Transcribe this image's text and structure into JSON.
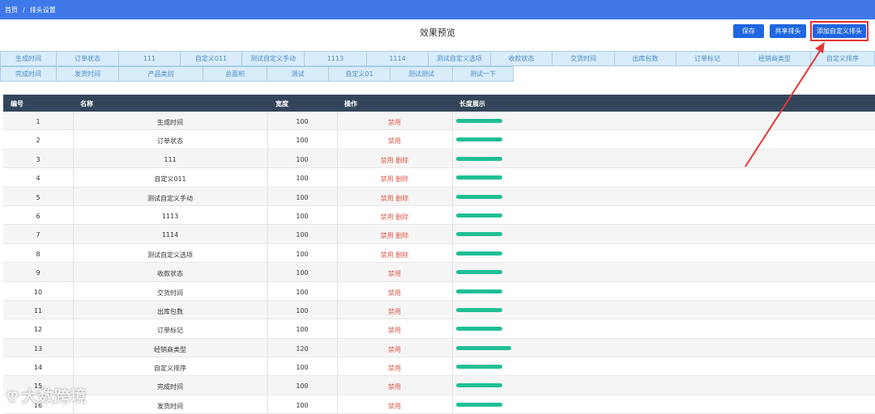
{
  "breadcrumb": [
    "首页",
    "排头设置"
  ],
  "breadcrumb_sep": "/",
  "preview_title": "效果预览",
  "buttons": {
    "save": "保存",
    "share": "共享排头",
    "add": "添加自定义排头"
  },
  "header_row1": [
    "生成时间",
    "订单状态",
    "111",
    "自定义011",
    "测试自定义手动",
    "1113",
    "1114",
    "测试自定义选项",
    "收款状态",
    "交货时间",
    "出库包数",
    "订单标记",
    "经销商类型",
    "自定义排序"
  ],
  "header_row2": [
    "完成时间",
    "发货时间",
    "产品类别",
    "总面积",
    "测试",
    "自定义01",
    "测试测试",
    "测试一下"
  ],
  "table": {
    "columns": [
      "编号",
      "名称",
      "宽度",
      "操作",
      "长度展示"
    ],
    "rows": [
      {
        "no": "1",
        "name": "生成时间",
        "width": "100",
        "ops": "禁用",
        "bar": 100
      },
      {
        "no": "2",
        "name": "订单状态",
        "width": "100",
        "ops": "禁用",
        "bar": 100
      },
      {
        "no": "3",
        "name": "111",
        "width": "100",
        "ops": "禁用 删除",
        "bar": 100
      },
      {
        "no": "4",
        "name": "自定义011",
        "width": "100",
        "ops": "禁用 删除",
        "bar": 100
      },
      {
        "no": "5",
        "name": "测试自定义手动",
        "width": "100",
        "ops": "禁用 删除",
        "bar": 100
      },
      {
        "no": "6",
        "name": "1113",
        "width": "100",
        "ops": "禁用 删除",
        "bar": 100
      },
      {
        "no": "7",
        "name": "1114",
        "width": "100",
        "ops": "禁用 删除",
        "bar": 100
      },
      {
        "no": "8",
        "name": "测试自定义选项",
        "width": "100",
        "ops": "禁用 删除",
        "bar": 100
      },
      {
        "no": "9",
        "name": "收款状态",
        "width": "100",
        "ops": "禁用",
        "bar": 100
      },
      {
        "no": "10",
        "name": "交货时间",
        "width": "100",
        "ops": "禁用",
        "bar": 100
      },
      {
        "no": "11",
        "name": "出库包数",
        "width": "100",
        "ops": "禁用",
        "bar": 100
      },
      {
        "no": "12",
        "name": "订单标记",
        "width": "100",
        "ops": "禁用",
        "bar": 100
      },
      {
        "no": "13",
        "name": "经销商类型",
        "width": "120",
        "ops": "禁用",
        "bar": 120
      },
      {
        "no": "14",
        "name": "自定义排序",
        "width": "100",
        "ops": "禁用",
        "bar": 100
      },
      {
        "no": "15",
        "name": "完成时间",
        "width": "100",
        "ops": "禁用",
        "bar": 100
      },
      {
        "no": "16",
        "name": "发货时间",
        "width": "100",
        "ops": "禁用",
        "bar": 100
      }
    ]
  },
  "watermark": "大数跨境",
  "colors": {
    "topbar": "#3f79e9",
    "button": "#1f66e0",
    "bar": "#1fbf95",
    "highlight": "#e53535",
    "thead": "#33455a"
  }
}
